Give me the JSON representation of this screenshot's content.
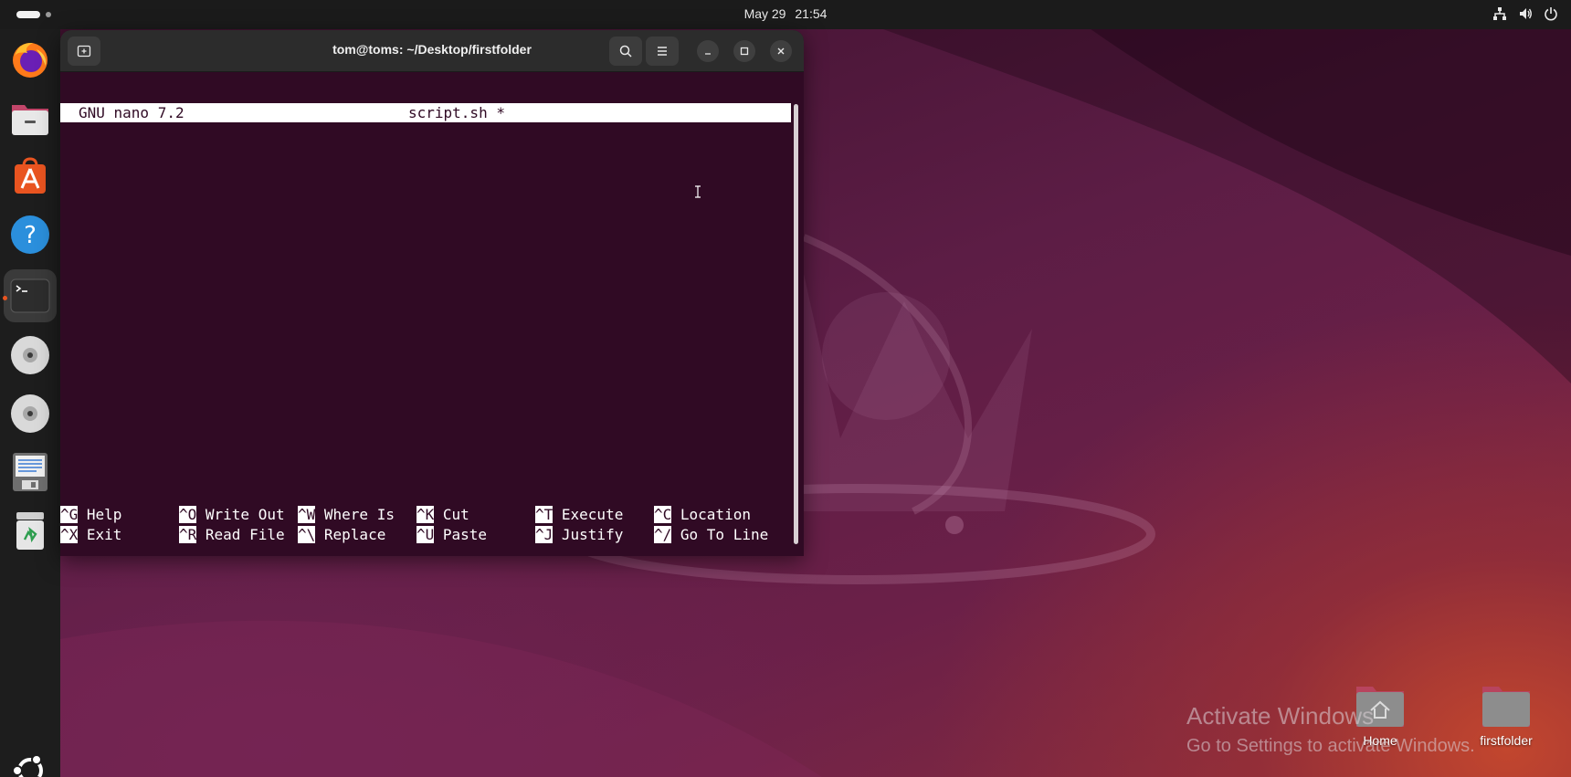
{
  "topbar": {
    "date": "May 29",
    "time": "21:54",
    "tray_icons": [
      "network-icon",
      "volume-icon",
      "power-icon"
    ]
  },
  "dock": {
    "items": [
      {
        "name": "firefox",
        "icon": "firefox-icon"
      },
      {
        "name": "files",
        "icon": "files-icon"
      },
      {
        "name": "app-center",
        "icon": "app-center-icon"
      },
      {
        "name": "help",
        "icon": "help-icon"
      },
      {
        "name": "terminal",
        "icon": "terminal-icon",
        "running": true
      },
      {
        "name": "disc-1",
        "icon": "optical-disc-icon"
      },
      {
        "name": "disc-2",
        "icon": "optical-disc-icon"
      },
      {
        "name": "text-editor",
        "icon": "text-editor-icon"
      },
      {
        "name": "trash",
        "icon": "trash-icon"
      },
      {
        "name": "show-apps",
        "icon": "ubuntu-logo-icon"
      }
    ]
  },
  "terminal": {
    "title": "tom@toms: ~/Desktop/firstfolder",
    "nano": {
      "version": "GNU nano 7.2",
      "filename": "script.sh *"
    },
    "shortcuts_row1": [
      {
        "key": "^G",
        "label": " Help"
      },
      {
        "key": "^O",
        "label": " Write Out"
      },
      {
        "key": "^W",
        "label": " Where Is"
      },
      {
        "key": "^K",
        "label": " Cut"
      },
      {
        "key": "^T",
        "label": " Execute"
      },
      {
        "key": "^C",
        "label": " Location"
      }
    ],
    "shortcuts_row2": [
      {
        "key": "^X",
        "label": " Exit"
      },
      {
        "key": "^R",
        "label": " Read File"
      },
      {
        "key": "^\\",
        "label": " Replace"
      },
      {
        "key": "^U",
        "label": " Paste"
      },
      {
        "key": "^J",
        "label": " Justify"
      },
      {
        "key": "^/",
        "label": " Go To Line"
      }
    ]
  },
  "desktop": {
    "icons": [
      {
        "label": "Home"
      },
      {
        "label": "firstfolder"
      }
    ],
    "watermark": {
      "line1": "Activate Windows",
      "line2": "Go to Settings to activate Windows."
    }
  },
  "colors": {
    "terminal_bg": "#300a24",
    "accent": "#e95420",
    "topbar_bg": "#1b1b1b"
  }
}
